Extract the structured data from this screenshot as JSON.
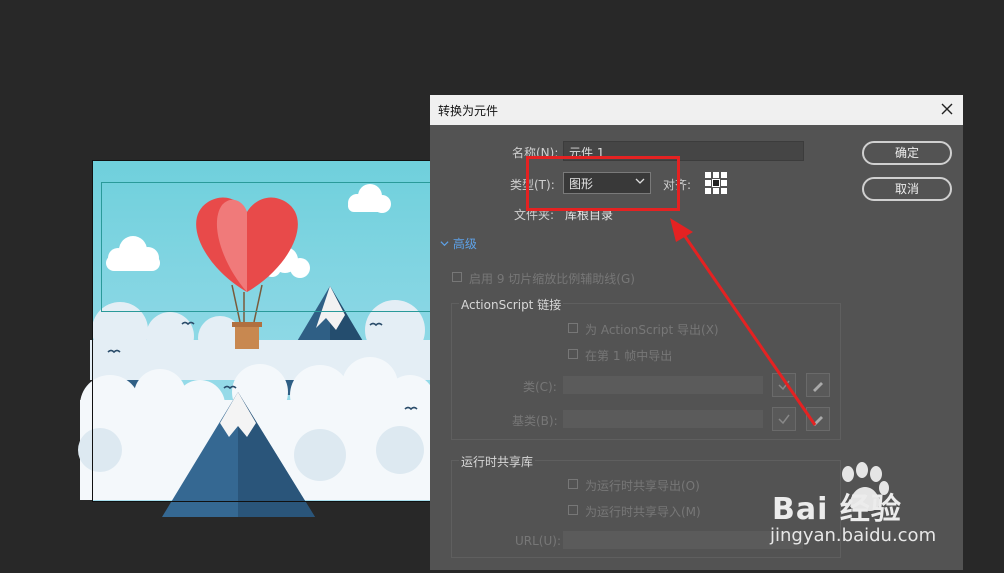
{
  "dialog": {
    "title": "转换为元件",
    "name_label": "名称(N):",
    "name_value": "元件 1",
    "type_label": "类型(T):",
    "type_value": "图形",
    "align_label": "对齐:",
    "folder_label": "文件夹:",
    "folder_value": "库根目录",
    "ok_label": "确定",
    "cancel_label": "取消",
    "advanced_label": "高级",
    "scale9_label": "启用 9 切片缩放比例辅助线(G)",
    "actionscript": {
      "section_label": "ActionScript 链接",
      "export_as_label": "为 ActionScript 导出(X)",
      "export_frame_label": "在第 1 帧中导出",
      "class_label": "类(C):",
      "base_class_label": "基类(B):"
    },
    "runtime": {
      "section_label": "运行时共享库",
      "export_label": "为运行时共享导出(O)",
      "import_label": "为运行时共享导入(M)",
      "url_label": "URL(U):"
    }
  },
  "watermark": {
    "brand": "Bai 经验",
    "url": "jingyan.baidu.com"
  },
  "colors": {
    "stage_bg": "#282828",
    "dialog_bg": "#535353",
    "highlight": "#e42222",
    "advanced_link": "#5ea2e8"
  }
}
